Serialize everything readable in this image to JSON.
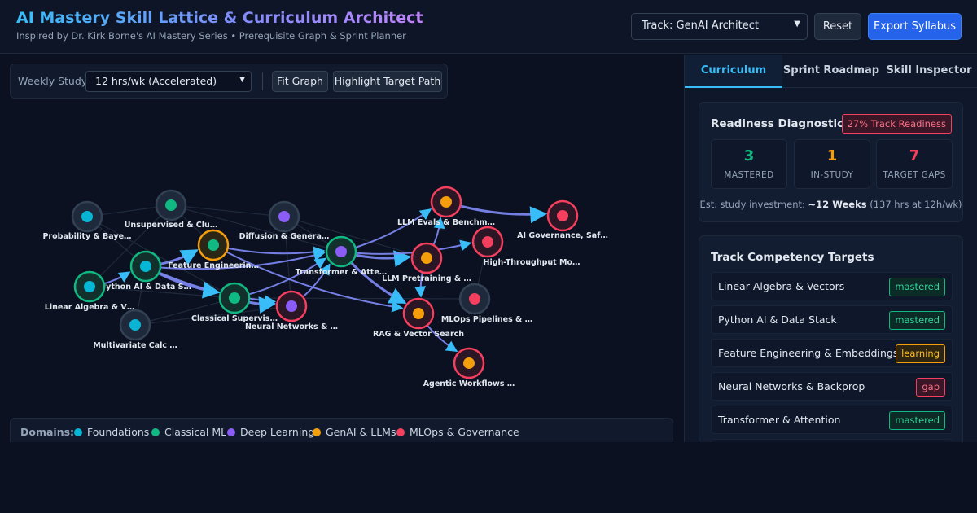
{
  "header": {
    "title": "AI Mastery Skill Lattice & Curriculum Architect",
    "subtitle": "Inspired by Dr. Kirk Borne's AI Mastery Series • Prerequisite Graph & Sprint Planner",
    "track_select": "Track: GenAI Architect",
    "reset_label": "Reset",
    "export_label": "Export Syllabus"
  },
  "toolbar": {
    "weekly_label": "Weekly Study:",
    "weekly_value": "12 hrs/wk (Accelerated)",
    "fit_label": "Fit Graph",
    "highlight_label": "Highlight Target Path"
  },
  "colors": {
    "foundations": "#06b6d4",
    "classical": "#10b981",
    "deep": "#8b5cf6",
    "genai": "#f59e0b",
    "mlops": "#f43f5e",
    "edge_path": "#818cf8",
    "arrow": "#38bdf8"
  },
  "graph": {
    "nodes": [
      {
        "id": "prob",
        "label": "Probability & Baye…",
        "domain": "foundations",
        "ring": "neutral"
      },
      {
        "id": "unsup",
        "label": "Unsupervised & Clu…",
        "domain": "classical",
        "ring": "neutral"
      },
      {
        "id": "diff",
        "label": "Diffusion & Genera…",
        "domain": "deep",
        "ring": "neutral"
      },
      {
        "id": "evals",
        "label": "LLM Evals & Benchm…",
        "domain": "genai",
        "ring": "target"
      },
      {
        "id": "gov",
        "label": "AI Governance, Saf…",
        "domain": "mlops",
        "ring": "target"
      },
      {
        "id": "feat",
        "label": "Feature Engineerin…",
        "domain": "classical",
        "ring": "learning"
      },
      {
        "id": "trans",
        "label": "Transformer & Atte…",
        "domain": "deep",
        "ring": "mastered"
      },
      {
        "id": "htp",
        "label": "High-Throughput Mo…",
        "domain": "mlops",
        "ring": "target"
      },
      {
        "id": "py",
        "label": "Python AI & Data S…",
        "domain": "foundations",
        "ring": "mastered"
      },
      {
        "id": "pretrain",
        "label": "LLM Pretraining & …",
        "domain": "genai",
        "ring": "target"
      },
      {
        "id": "linalg",
        "label": "Linear Algebra & V…",
        "domain": "foundations",
        "ring": "mastered"
      },
      {
        "id": "csup",
        "label": "Classical Supervis…",
        "domain": "classical",
        "ring": "mastered"
      },
      {
        "id": "nn",
        "label": "Neural Networks & …",
        "domain": "deep",
        "ring": "target"
      },
      {
        "id": "mlops",
        "label": "MLOps Pipelines & …",
        "domain": "mlops",
        "ring": "neutral"
      },
      {
        "id": "rag",
        "label": "RAG & Vector Search",
        "domain": "genai",
        "ring": "target"
      },
      {
        "id": "calc",
        "label": "Multivariate Calc …",
        "domain": "foundations",
        "ring": "neutral"
      },
      {
        "id": "agent",
        "label": "Agentic Workflows …",
        "domain": "genai",
        "ring": "target"
      }
    ],
    "edges": [
      [
        "py",
        "feat"
      ],
      [
        "py",
        "trans"
      ],
      [
        "py",
        "nn"
      ],
      [
        "py",
        "csup"
      ],
      [
        "feat",
        "trans"
      ],
      [
        "feat",
        "rag"
      ],
      [
        "csup",
        "nn"
      ],
      [
        "csup",
        "trans"
      ],
      [
        "nn",
        "trans"
      ],
      [
        "trans",
        "pretrain"
      ],
      [
        "trans",
        "htp"
      ],
      [
        "trans",
        "evals"
      ],
      [
        "trans",
        "rag"
      ],
      [
        "pretrain",
        "rag"
      ],
      [
        "pretrain",
        "evals"
      ],
      [
        "evals",
        "gov"
      ],
      [
        "rag",
        "agent"
      ],
      [
        "linalg",
        "py"
      ]
    ],
    "faint_edges": [
      [
        "prob",
        "unsup"
      ],
      [
        "prob",
        "py"
      ],
      [
        "prob",
        "csup"
      ],
      [
        "unsup",
        "diff"
      ],
      [
        "unsup",
        "feat"
      ],
      [
        "linalg",
        "unsup"
      ],
      [
        "linalg",
        "csup"
      ],
      [
        "calc",
        "py"
      ],
      [
        "calc",
        "csup"
      ],
      [
        "diff",
        "trans"
      ],
      [
        "diff",
        "nn"
      ],
      [
        "csup",
        "mlops"
      ],
      [
        "mlops",
        "htp"
      ],
      [
        "unsup",
        "trans"
      ],
      [
        "diff",
        "pretrain"
      ],
      [
        "calc",
        "nn"
      ]
    ]
  },
  "legend": {
    "title": "Domains:",
    "items": [
      {
        "label": "Foundations",
        "color": "#06b6d4"
      },
      {
        "label": "Classical ML",
        "color": "#10b981"
      },
      {
        "label": "Deep Learning",
        "color": "#8b5cf6"
      },
      {
        "label": "GenAI & LLMs",
        "color": "#f59e0b"
      },
      {
        "label": "MLOps & Governance",
        "color": "#f43f5e"
      }
    ]
  },
  "tabs": [
    "Curriculum",
    "Sprint Roadmap",
    "Skill Inspector"
  ],
  "readiness": {
    "title": "Readiness Diagnostic",
    "badge": "27% Track Readiness",
    "mastered_value": "3",
    "mastered_label": "MASTERED",
    "instudy_value": "1",
    "instudy_label": "IN-STUDY",
    "gaps_value": "7",
    "gaps_label": "TARGET GAPS",
    "investment_prefix": "Est. study investment:",
    "investment_bold": "~12 Weeks",
    "investment_suffix": "(137 hrs at 12h/wk)"
  },
  "targets": {
    "title": "Track Competency Targets",
    "rows": [
      {
        "name": "Linear Algebra & Vectors",
        "status": "mastered"
      },
      {
        "name": "Python AI & Data Stack",
        "status": "mastered"
      },
      {
        "name": "Feature Engineering & Embeddings",
        "status": "learning"
      },
      {
        "name": "Neural Networks & Backprop",
        "status": "gap"
      },
      {
        "name": "Transformer & Attention",
        "status": "mastered"
      }
    ]
  }
}
